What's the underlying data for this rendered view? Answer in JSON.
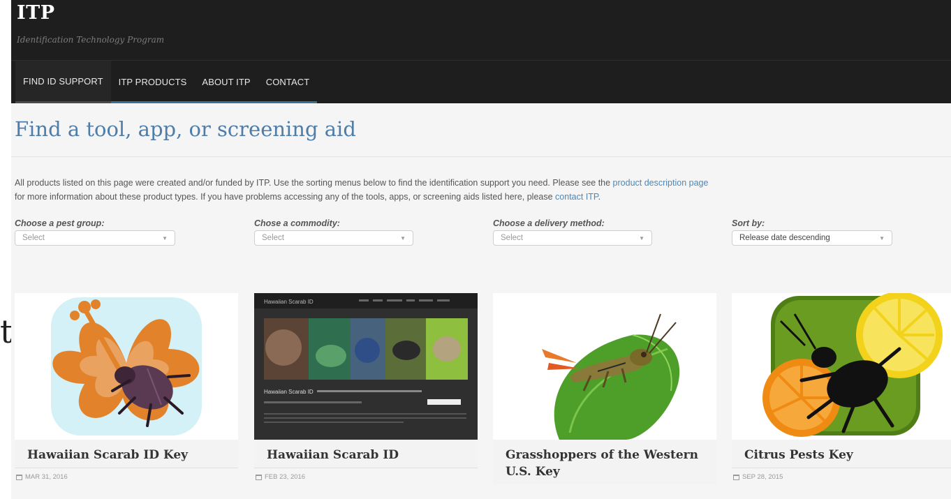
{
  "header": {
    "title": "ITP",
    "subtitle": "Identification Technology Program"
  },
  "nav": {
    "items": [
      {
        "label": "FIND ID SUPPORT"
      },
      {
        "label": "ITP PRODUCTS"
      },
      {
        "label": "ABOUT ITP"
      },
      {
        "label": "CONTACT"
      }
    ]
  },
  "page": {
    "title": "Find a tool, app, or screening aid",
    "intro_1": "All products listed on this page were created and/or funded by ITP. Use the sorting menus below to find the identification support you need. Please see the ",
    "intro_link_1": "product description page",
    "intro_2": "for more information about these product types. If you have problems accessing any of the tools, apps, or screening aids listed here, please ",
    "intro_link_2": "contact ITP",
    "intro_end": "."
  },
  "filters": [
    {
      "label": "Choose a pest group:",
      "value": "Select"
    },
    {
      "label": "Chose a commodity:",
      "value": "Select"
    },
    {
      "label": "Choose a delivery method:",
      "value": "Select"
    },
    {
      "label": "Sort by:",
      "value": "Release date descending"
    }
  ],
  "cards": [
    {
      "title": "Hawaiian Scarab ID Key",
      "date": "MAR 31, 2016"
    },
    {
      "title": "Hawaiian Scarab ID",
      "date": "FEB 23, 2016"
    },
    {
      "title": "Grasshoppers of the Western U.S. Key",
      "date": ""
    },
    {
      "title": "Citrus Pests Key",
      "date": "SEP 28, 2015"
    }
  ],
  "card_screenshot": {
    "site_name": "Hawaiian Scarab ID",
    "heading": "Hawaiian Scarab ID"
  },
  "left_glyph": "t",
  "colors": {
    "header_bg": "#1e1e1e",
    "accent_blue": "#4d7da8",
    "link_blue": "#4d86b8",
    "nav_underline": "#3c6f94"
  }
}
